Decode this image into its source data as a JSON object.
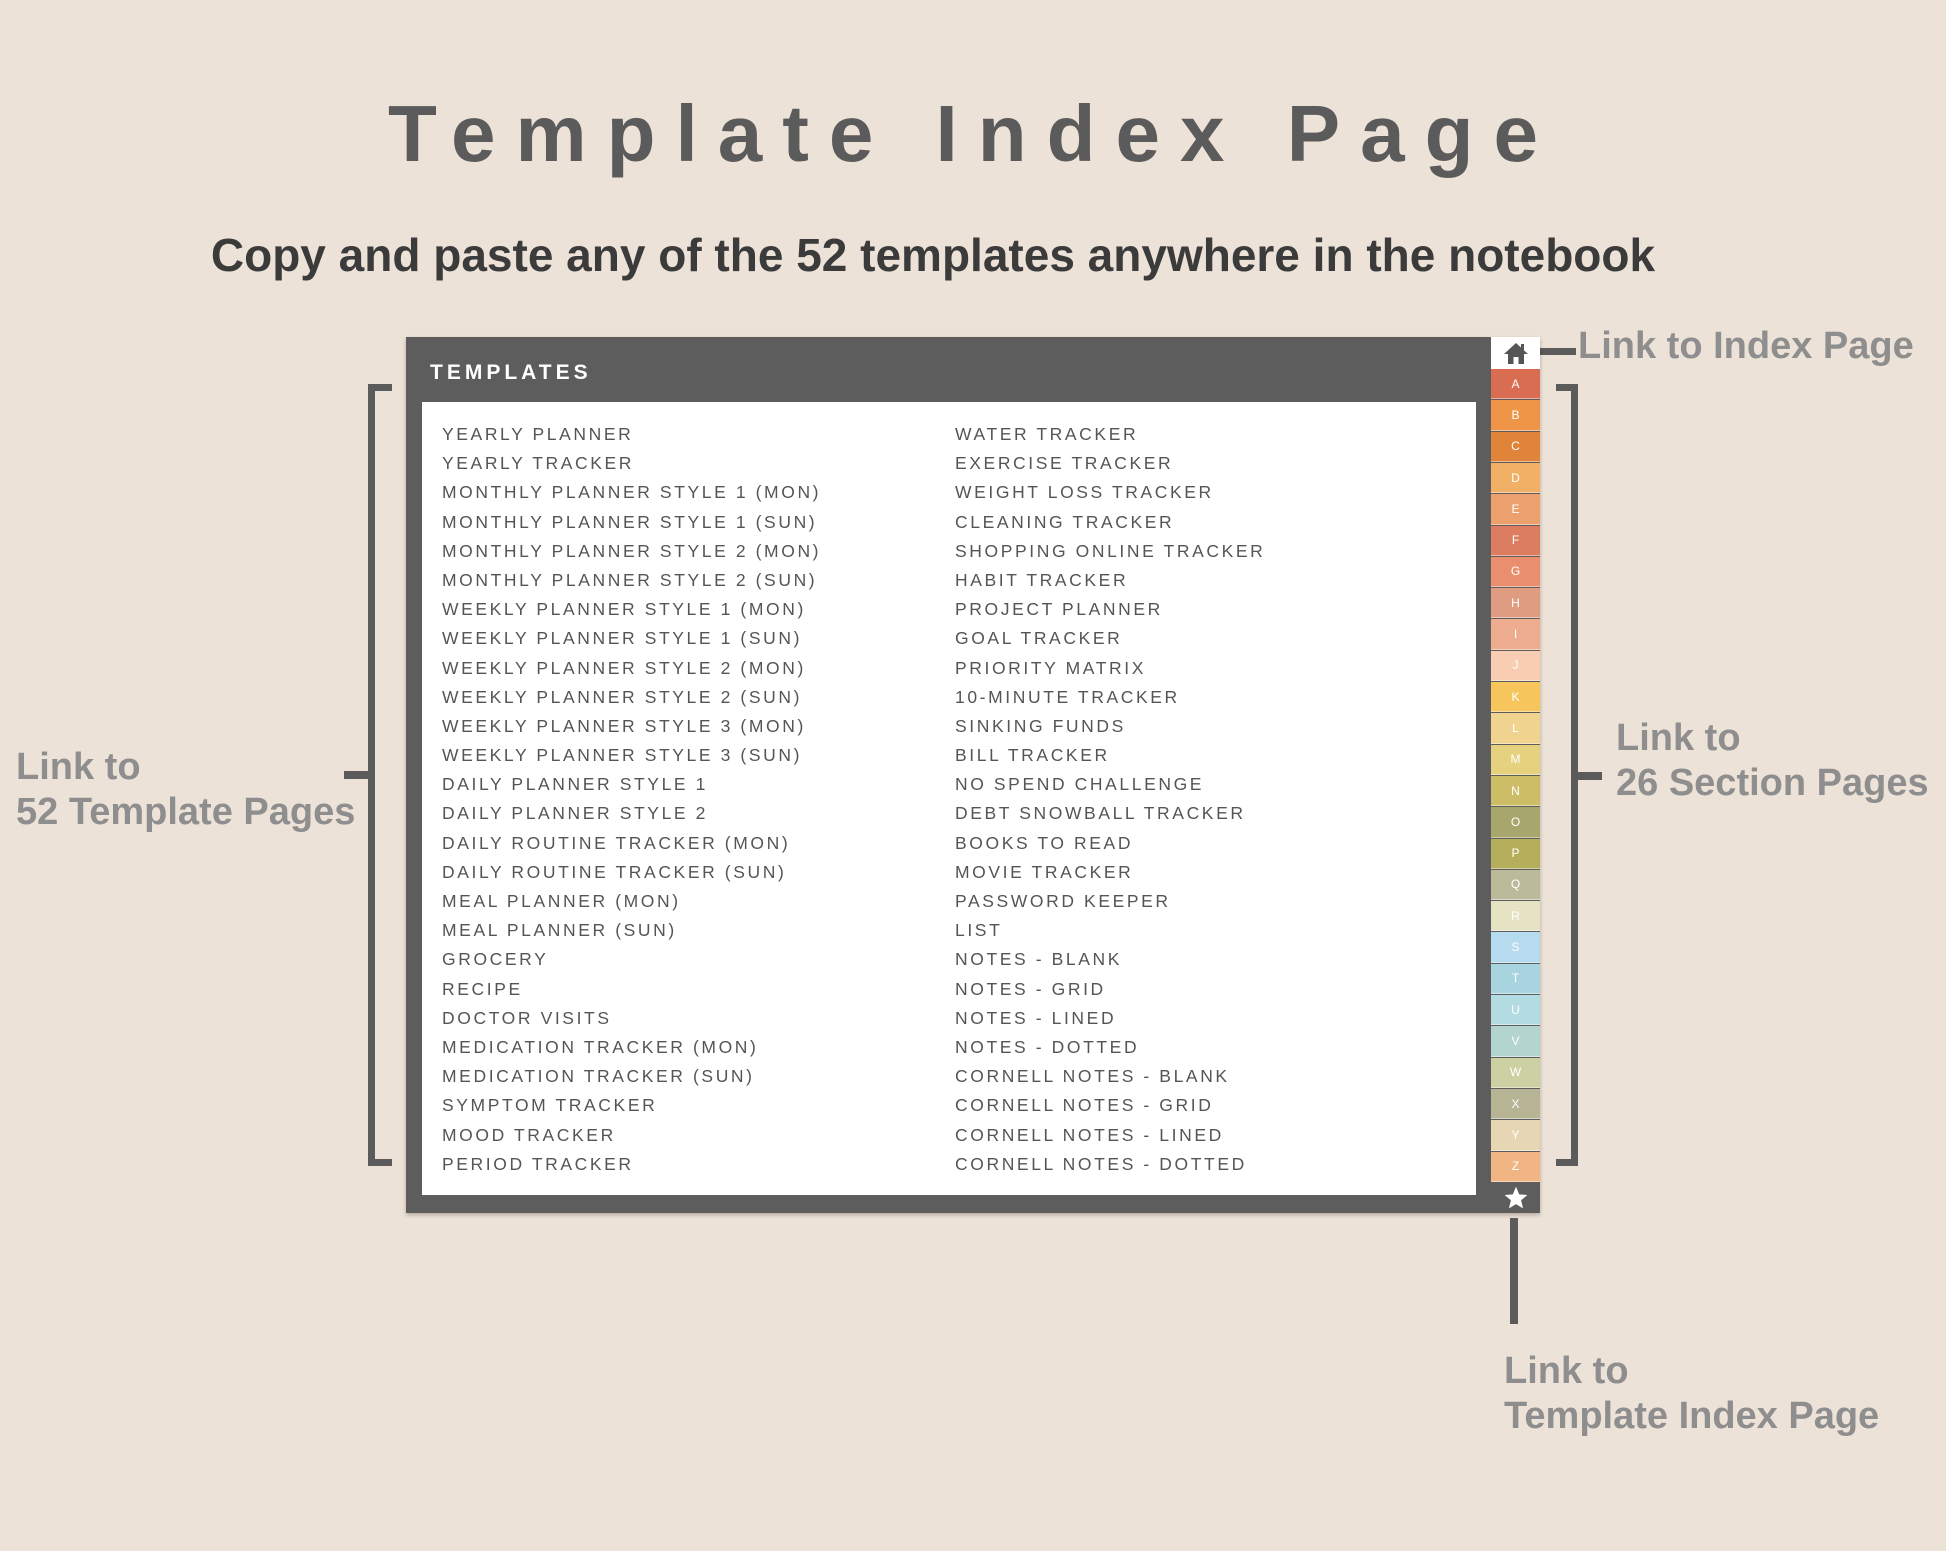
{
  "header": {
    "title": "Template Index Page",
    "subtitle": "Copy and paste any of the 52 templates anywhere in the notebook"
  },
  "callouts": {
    "index": "Link to Index Page",
    "templates": [
      "Link to",
      "52 Template Pages"
    ],
    "sections": [
      "Link to",
      "26 Section Pages"
    ],
    "template_index": [
      "Link to",
      "Template Index Page"
    ]
  },
  "page": {
    "title": "TEMPLATES",
    "left_column": [
      "YEARLY PLANNER",
      "YEARLY TRACKER",
      "MONTHLY PLANNER STYLE 1 (MON)",
      "MONTHLY PLANNER STYLE 1 (SUN)",
      "MONTHLY PLANNER STYLE 2 (MON)",
      "MONTHLY PLANNER STYLE 2 (SUN)",
      "WEEKLY PLANNER STYLE 1 (MON)",
      "WEEKLY PLANNER STYLE 1 (SUN)",
      "WEEKLY PLANNER STYLE 2 (MON)",
      "WEEKLY PLANNER STYLE 2 (SUN)",
      "WEEKLY PLANNER STYLE 3 (MON)",
      "WEEKLY PLANNER STYLE 3 (SUN)",
      "DAILY PLANNER STYLE 1",
      "DAILY PLANNER STYLE 2",
      "DAILY ROUTINE TRACKER (MON)",
      "DAILY ROUTINE TRACKER (SUN)",
      "MEAL PLANNER (MON)",
      "MEAL PLANNER (SUN)",
      "GROCERY",
      "RECIPE",
      "DOCTOR VISITS",
      "MEDICATION TRACKER (MON)",
      "MEDICATION TRACKER (SUN)",
      "SYMPTOM TRACKER",
      "MOOD TRACKER",
      "PERIOD TRACKER"
    ],
    "right_column": [
      "WATER TRACKER",
      "EXERCISE TRACKER",
      "WEIGHT LOSS TRACKER",
      "CLEANING TRACKER",
      "SHOPPING ONLINE TRACKER",
      "HABIT TRACKER",
      "PROJECT PLANNER",
      "GOAL TRACKER",
      "PRIORITY MATRIX",
      "10-MINUTE TRACKER",
      "SINKING FUNDS",
      "BILL TRACKER",
      "NO SPEND CHALLENGE",
      "DEBT SNOWBALL TRACKER",
      "BOOKS TO READ",
      "MOVIE TRACKER",
      "PASSWORD KEEPER",
      "LIST",
      "NOTES - BLANK",
      "NOTES - GRID",
      "NOTES - LINED",
      "NOTES - DOTTED",
      "CORNELL NOTES - BLANK",
      "CORNELL NOTES - GRID",
      "CORNELL NOTES - LINED",
      "CORNELL NOTES - DOTTED"
    ]
  },
  "tabs": {
    "home_icon": "home-icon",
    "star_icon": "star-icon",
    "letters": [
      {
        "label": "A",
        "color": "#d96d52"
      },
      {
        "label": "B",
        "color": "#ef9547"
      },
      {
        "label": "C",
        "color": "#e0843a"
      },
      {
        "label": "D",
        "color": "#f2b066"
      },
      {
        "label": "E",
        "color": "#eba06e"
      },
      {
        "label": "F",
        "color": "#dc7d62"
      },
      {
        "label": "G",
        "color": "#e98f6e"
      },
      {
        "label": "H",
        "color": "#df9c80"
      },
      {
        "label": "I",
        "color": "#ecac8d"
      },
      {
        "label": "J",
        "color": "#f8cdb1"
      },
      {
        "label": "K",
        "color": "#f6c65c"
      },
      {
        "label": "L",
        "color": "#efd38f"
      },
      {
        "label": "M",
        "color": "#e6d27e"
      },
      {
        "label": "N",
        "color": "#cdbd66"
      },
      {
        "label": "O",
        "color": "#a7a66c"
      },
      {
        "label": "P",
        "color": "#b5ae5a"
      },
      {
        "label": "Q",
        "color": "#bbbb9c"
      },
      {
        "label": "R",
        "color": "#e5e3c4"
      },
      {
        "label": "S",
        "color": "#b7dbee"
      },
      {
        "label": "T",
        "color": "#a8d4df"
      },
      {
        "label": "U",
        "color": "#b3dbe2"
      },
      {
        "label": "V",
        "color": "#b4d4d0"
      },
      {
        "label": "W",
        "color": "#ccd0a3"
      },
      {
        "label": "X",
        "color": "#b7b496"
      },
      {
        "label": "Y",
        "color": "#e7d6b4"
      },
      {
        "label": "Z",
        "color": "#f0b582"
      }
    ]
  }
}
